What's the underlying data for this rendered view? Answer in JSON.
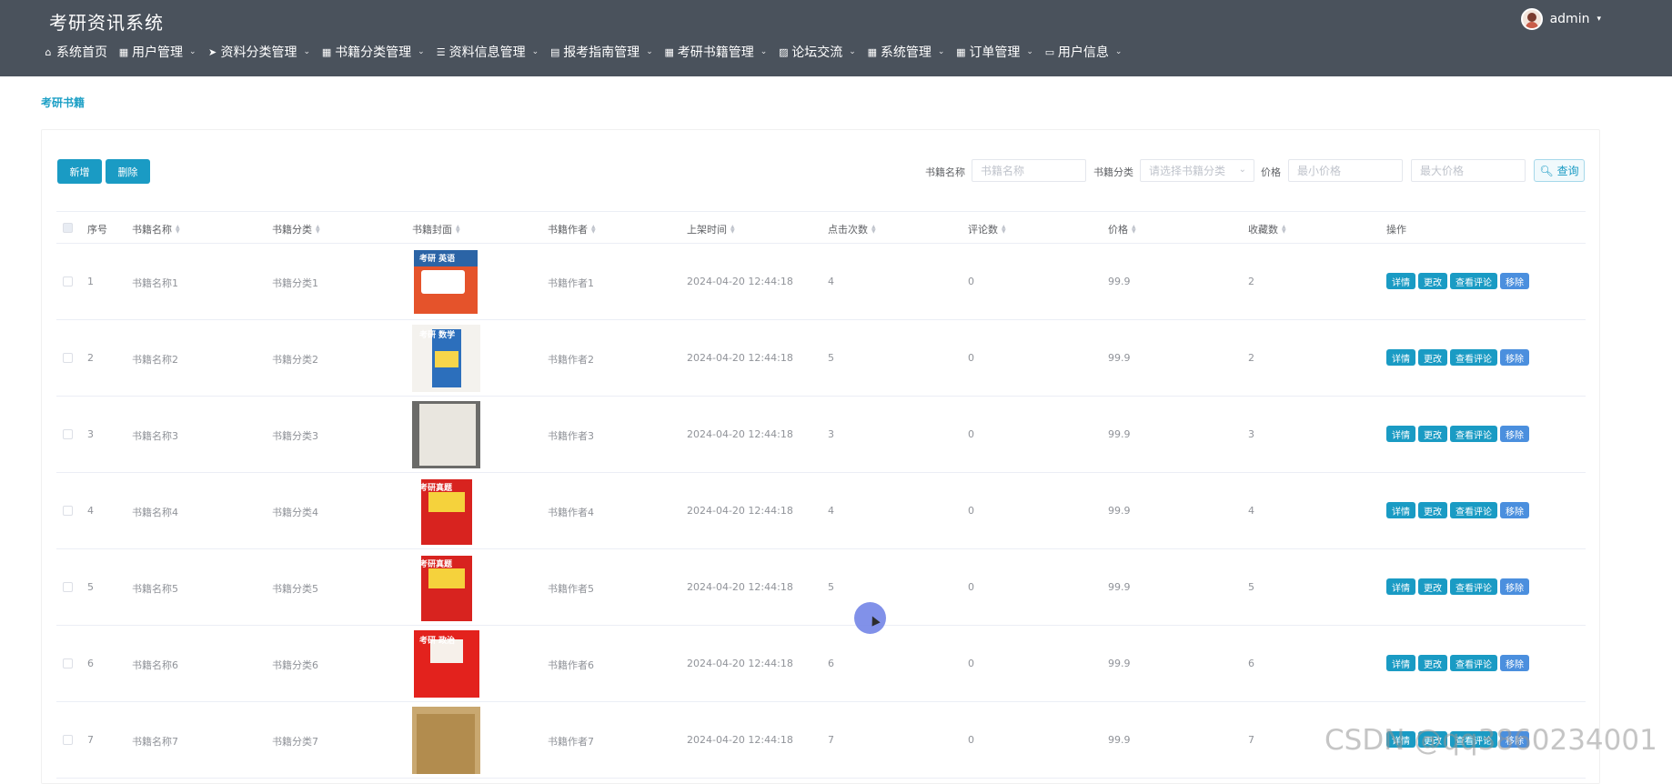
{
  "app": {
    "title": "考研资讯系统",
    "user": "admin"
  },
  "nav": [
    {
      "icon": "home-icon",
      "glyph": "⌂",
      "label": "系统首页",
      "dropdown": false
    },
    {
      "icon": "grid-icon",
      "glyph": "▦",
      "label": "用户管理",
      "dropdown": true
    },
    {
      "icon": "send-icon",
      "glyph": "➤",
      "label": "资料分类管理",
      "dropdown": true
    },
    {
      "icon": "grid-icon",
      "glyph": "▦",
      "label": "书籍分类管理",
      "dropdown": true
    },
    {
      "icon": "list-icon",
      "glyph": "☰",
      "label": "资料信息管理",
      "dropdown": true
    },
    {
      "icon": "print-icon",
      "glyph": "▤",
      "label": "报考指南管理",
      "dropdown": true
    },
    {
      "icon": "grid-icon",
      "glyph": "▦",
      "label": "考研书籍管理",
      "dropdown": true
    },
    {
      "icon": "picture-icon",
      "glyph": "▨",
      "label": "论坛交流",
      "dropdown": true
    },
    {
      "icon": "grid-icon",
      "glyph": "▦",
      "label": "系统管理",
      "dropdown": true
    },
    {
      "icon": "grid-icon",
      "glyph": "▦",
      "label": "订单管理",
      "dropdown": true
    },
    {
      "icon": "card-icon",
      "glyph": "▭",
      "label": "用户信息",
      "dropdown": true
    }
  ],
  "breadcrumb": "考研书籍",
  "toolbar": {
    "add": "新增",
    "delete": "删除"
  },
  "search": {
    "name_label": "书籍名称",
    "name_placeholder": "书籍名称",
    "category_label": "书籍分类",
    "category_placeholder": "请选择书籍分类",
    "price_label": "价格",
    "min_placeholder": "最小价格",
    "max_placeholder": "最大价格",
    "query": "查询"
  },
  "columns": [
    "序号",
    "书籍名称",
    "书籍分类",
    "书籍封面",
    "书籍作者",
    "上架时间",
    "点击次数",
    "评论数",
    "价格",
    "收藏数",
    "操作"
  ],
  "actions": {
    "detail": "详情",
    "edit": "更改",
    "comments": "查看评论",
    "remove": "移除"
  },
  "rows": [
    {
      "idx": "1",
      "name": "书籍名称1",
      "category": "书籍分类1",
      "cover": "bk1",
      "cover_text": "考研 英语",
      "author": "书籍作者1",
      "time": "2024-04-20 12:44:18",
      "clicks": "4",
      "comments": "0",
      "price": "99.9",
      "favorites": "2"
    },
    {
      "idx": "2",
      "name": "书籍名称2",
      "category": "书籍分类2",
      "cover": "bk2",
      "cover_text": "考研 数学",
      "author": "书籍作者2",
      "time": "2024-04-20 12:44:18",
      "clicks": "5",
      "comments": "0",
      "price": "99.9",
      "favorites": "2"
    },
    {
      "idx": "3",
      "name": "书籍名称3",
      "category": "书籍分类3",
      "cover": "bk3",
      "cover_text": "",
      "author": "书籍作者3",
      "time": "2024-04-20 12:44:18",
      "clicks": "3",
      "comments": "0",
      "price": "99.9",
      "favorites": "3"
    },
    {
      "idx": "4",
      "name": "书籍名称4",
      "category": "书籍分类4",
      "cover": "bk4",
      "cover_text": "考研真题",
      "author": "书籍作者4",
      "time": "2024-04-20 12:44:18",
      "clicks": "4",
      "comments": "0",
      "price": "99.9",
      "favorites": "4"
    },
    {
      "idx": "5",
      "name": "书籍名称5",
      "category": "书籍分类5",
      "cover": "bk4",
      "cover_text": "考研真题",
      "author": "书籍作者5",
      "time": "2024-04-20 12:44:18",
      "clicks": "5",
      "comments": "0",
      "price": "99.9",
      "favorites": "5"
    },
    {
      "idx": "6",
      "name": "书籍名称6",
      "category": "书籍分类6",
      "cover": "bk6",
      "cover_text": "考研 政治",
      "author": "书籍作者6",
      "time": "2024-04-20 12:44:18",
      "clicks": "6",
      "comments": "0",
      "price": "99.9",
      "favorites": "6"
    },
    {
      "idx": "7",
      "name": "书籍名称7",
      "category": "书籍分类7",
      "cover": "bk7",
      "cover_text": "",
      "author": "书籍作者7",
      "time": "2024-04-20 12:44:18",
      "clicks": "7",
      "comments": "0",
      "price": "99.9",
      "favorites": "7"
    }
  ],
  "watermark": "CSDN @qq3860234001"
}
